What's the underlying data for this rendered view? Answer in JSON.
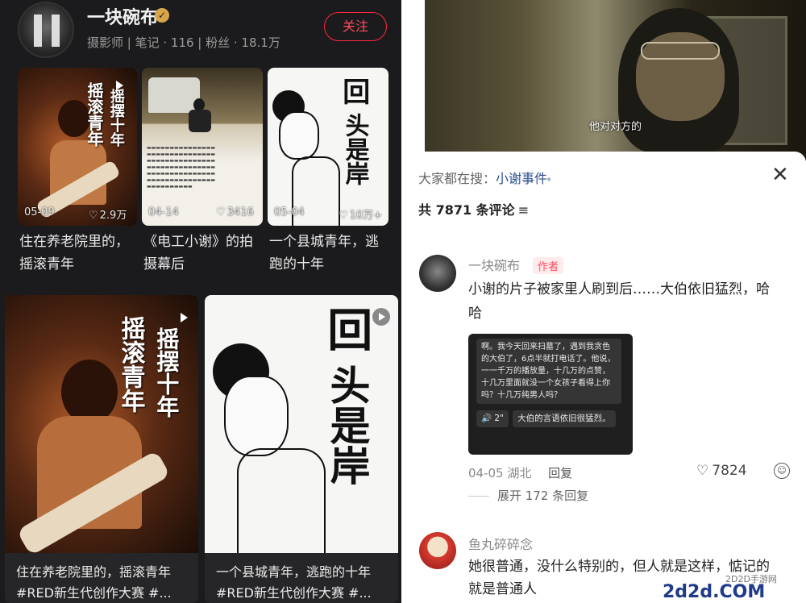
{
  "profile": {
    "username": "一块碗布",
    "verified_icon": "✓",
    "meta": "摄影师 | 笔记 · 116 | 粉丝 · 18.1万",
    "follow_label": "关注"
  },
  "cards": [
    {
      "title_art": [
        "摇滚青年",
        "摇摆十年"
      ],
      "date": "05-09",
      "likes": "2.9万",
      "caption": "住在养老院里的，摇滚青年"
    },
    {
      "title_art": [],
      "date": "04-14",
      "likes": "3416",
      "caption": "《电工小谢》的拍摄幕后"
    },
    {
      "title_art": [
        "回",
        "头是岸"
      ],
      "date": "05-04",
      "likes": "10万+",
      "caption": "一个县城青年，逃跑的十年"
    },
    {
      "title_art": [
        "摇滚青年",
        "摇摆十年"
      ],
      "caption_line1": "住在养老院里的，摇滚青年",
      "caption_line2": "#RED新生代创作大赛 #..."
    },
    {
      "title_art": [
        "回",
        "头是岸"
      ],
      "caption_line1": "一个县城青年，逃跑的十年",
      "caption_line2": "#RED新生代创作大赛 #..."
    }
  ],
  "video": {
    "subtitle": "他对对方的"
  },
  "comments_panel": {
    "search_prefix": "大家都在搜：",
    "search_term": "小谢事件",
    "close_icon": "✕",
    "count_label": "共 7871 条评论",
    "filter_icon": "≡"
  },
  "comment1": {
    "name": "一块碗布",
    "tag": "作者",
    "text_line1": "小谢的片子被家里人刷到后……大伯依旧猛烈，哈",
    "text_line2": "哈",
    "chat": {
      "msg1": "啊。我今天回来扫墓了，遇到我贪色的大伯了，6点半就打电话了。他说，一一千万的播放量，十几万的点赞，十几万里面就没一个女孩子看得上你吗？十几万纯男人吗？",
      "voice": "🔊 2\"",
      "msg2": "大伯的言语依旧很猛烈。"
    },
    "date_loc": "04-05 湖北",
    "reply_label": "回复",
    "likes": "7824",
    "expand_label": "展开 172 条回复"
  },
  "comment2": {
    "name": "鱼丸碎碎念",
    "text_line1": "她很普通，没什么特别的，但人就是这样，惦记的",
    "text_line2": "就是普通人"
  },
  "watermark": {
    "small": "2D2D手游网",
    "logo": "2d2d.COM"
  }
}
